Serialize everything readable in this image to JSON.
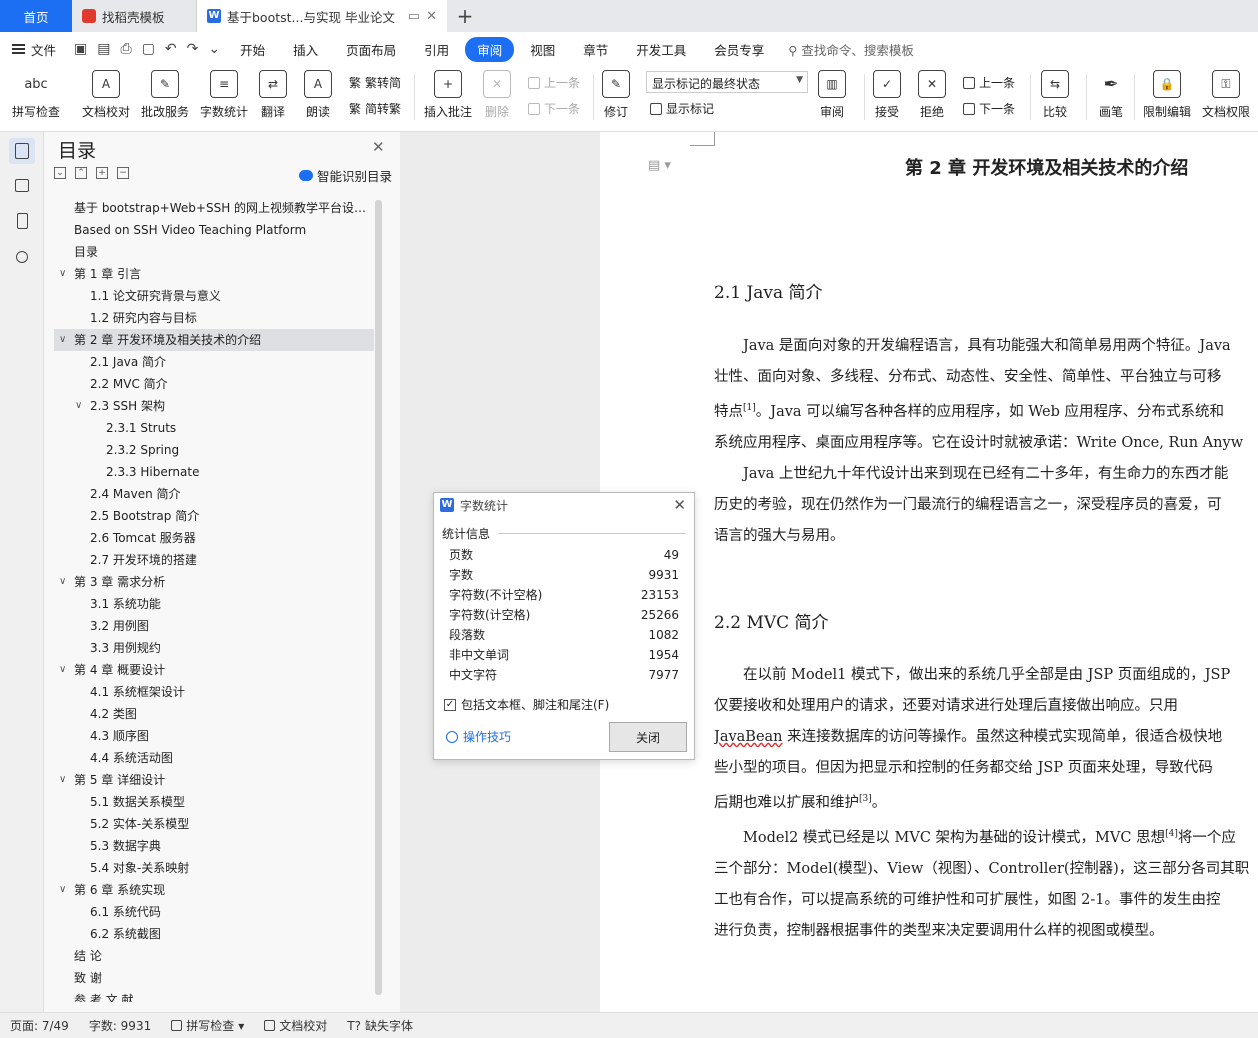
{
  "tabs": {
    "home": "首页",
    "find_template": "找稻壳模板",
    "doc": "基于bootst...与实现 毕业论文",
    "plus": "+"
  },
  "menu": {
    "file": "文件",
    "items": [
      "开始",
      "插入",
      "页面布局",
      "引用",
      "审阅",
      "视图",
      "章节",
      "开发工具",
      "会员专享"
    ],
    "active": "审阅",
    "search": "查找命令、搜索模板"
  },
  "ribbon": {
    "spellcheck": "拼写检查",
    "doc_proof": "文档校对",
    "review_service": "批改服务",
    "word_count": "字数统计",
    "translate": "翻译",
    "read_aloud": "朗读",
    "trad_to_simp": "繁转简",
    "simp_to_trad": "简转繁",
    "insert_comment": "插入批注",
    "delete": "删除",
    "prev": "上一条",
    "next": "下一条",
    "track": "修订",
    "markup_state": "显示标记的最终状态",
    "show_markup": "显示标记",
    "review": "审阅",
    "accept": "接受",
    "reject": "拒绝",
    "prev2": "上一条",
    "next2": "下一条",
    "compare": "比较",
    "pen": "画笔",
    "restrict_edit": "限制编辑",
    "doc_rights": "文档权限",
    "abc": "abc"
  },
  "toc": {
    "title": "目录",
    "smart": "智能识别目录",
    "items": [
      {
        "text": "基于 bootstrap+Web+SSH 的网上视频教学平台设计与实现",
        "level": 0,
        "chev": false
      },
      {
        "text": "Based on SSH Video Teaching Platform",
        "level": 0,
        "chev": false
      },
      {
        "text": "目录",
        "level": 0,
        "chev": false
      },
      {
        "text": "第 1 章  引言",
        "level": 0,
        "chev": true
      },
      {
        "text": "1.1  论文研究背景与意义",
        "level": 1,
        "chev": false
      },
      {
        "text": "1.2  研究内容与目标",
        "level": 1,
        "chev": false
      },
      {
        "text": "第 2 章  开发环境及相关技术的介绍",
        "level": 0,
        "chev": true,
        "sel": true
      },
      {
        "text": "2.1 Java 简介",
        "level": 1,
        "chev": false
      },
      {
        "text": "2.2 MVC 简介",
        "level": 1,
        "chev": false
      },
      {
        "text": "2.3 SSH 架构",
        "level": 1,
        "chev": true
      },
      {
        "text": "2.3.1 Struts",
        "level": 2,
        "chev": false
      },
      {
        "text": "2.3.2 Spring",
        "level": 2,
        "chev": false
      },
      {
        "text": "2.3.3 Hibernate",
        "level": 2,
        "chev": false
      },
      {
        "text": "2.4 Maven 简介",
        "level": 1,
        "chev": false
      },
      {
        "text": "2.5 Bootstrap 简介",
        "level": 1,
        "chev": false
      },
      {
        "text": "2.6 Tomcat 服务器",
        "level": 1,
        "chev": false
      },
      {
        "text": "2.7  开发环境的搭建",
        "level": 1,
        "chev": false
      },
      {
        "text": "第 3 章  需求分析",
        "level": 0,
        "chev": true
      },
      {
        "text": "3.1  系统功能",
        "level": 1,
        "chev": false
      },
      {
        "text": "3.2  用例图",
        "level": 1,
        "chev": false
      },
      {
        "text": "3.3  用例规约",
        "level": 1,
        "chev": false
      },
      {
        "text": "第 4 章  概要设计",
        "level": 0,
        "chev": true
      },
      {
        "text": "4.1  系统框架设计",
        "level": 1,
        "chev": false
      },
      {
        "text": "4.2  类图",
        "level": 1,
        "chev": false
      },
      {
        "text": "4.3  顺序图",
        "level": 1,
        "chev": false
      },
      {
        "text": "4.4  系统活动图",
        "level": 1,
        "chev": false
      },
      {
        "text": "第 5 章  详细设计",
        "level": 0,
        "chev": true
      },
      {
        "text": "5.1  数据关系模型",
        "level": 1,
        "chev": false
      },
      {
        "text": "5.2  实体-关系模型",
        "level": 1,
        "chev": false
      },
      {
        "text": "5.3  数据字典",
        "level": 1,
        "chev": false
      },
      {
        "text": "5.4  对象-关系映射",
        "level": 1,
        "chev": false
      },
      {
        "text": "第 6 章  系统实现",
        "level": 0,
        "chev": true
      },
      {
        "text": "6.1  系统代码",
        "level": 1,
        "chev": false
      },
      {
        "text": "6.2  系统截图",
        "level": 1,
        "chev": false
      },
      {
        "text": "结   论",
        "level": 0,
        "chev": false
      },
      {
        "text": "致   谢",
        "level": 0,
        "chev": false
      },
      {
        "text": "参 考 文 献",
        "level": 0,
        "chev": false
      }
    ]
  },
  "doc": {
    "chapter": "第 2 章  开发环境及相关技术的介绍",
    "sec1": "2.1 Java 简介",
    "p1": [
      "Java 是面向对象的开发编程语言，具有功能强大和简单易用两个特征。Java",
      "壮性、面向对象、多线程、分布式、动态性、安全性、简单性、平台独立与可移",
      "特点",
      "。Java 可以编写各种各样的应用程序，如 Web 应用程序、分布式系统和",
      "系统应用程序、桌面应用程序等。它在设计时就被承诺：Write Once, Run Anyw",
      "Java 上世纪九十年代设计出来到现在已经有二十多年，有生命力的东西才能",
      "历史的考验，现在仍然作为一门最流行的编程语言之一，深受程序员的喜爱，可",
      "语言的强大与易用。"
    ],
    "sec2": "2.2 MVC 简介",
    "p2": [
      "在以前 Model1 模式下，做出来的系统几乎全部是由 JSP 页面组成的，JSP",
      "仅要接收和处理用户的请求，还要对请求进行处理后直接做出响应。只用",
      "JavaBean",
      " 来连接数据库的访问等操作。虽然这种模式实现简单，很适合极快地",
      "些小型的项目。但因为把显示和控制的任务都交给 JSP 页面来处理，导致代码",
      "后期也难以扩展和维护",
      "。",
      "Model2 模式已经是以 MVC 架构为基础的设计模式，MVC 思想",
      "将一个应",
      "三个部分：Model(模型)、View（视图）、Controller(控制器)，这三部分各司其职",
      "工也有合作，可以提高系统的可维护性和可扩展性，如图 2-1。事件的发生由控",
      "进行负责，控制器根据事件的类型来决定要调用什么样的视图或模型。"
    ],
    "refs": {
      "r1": "[1]",
      "r3": "[3]",
      "r4": "[4]"
    }
  },
  "dialog": {
    "title": "字数统计",
    "group": "统计信息",
    "stats": [
      {
        "label": "页数",
        "value": "49"
      },
      {
        "label": "字数",
        "value": "9931"
      },
      {
        "label": "字符数(不计空格)",
        "value": "23153"
      },
      {
        "label": "字符数(计空格)",
        "value": "25266"
      },
      {
        "label": "段落数",
        "value": "1082"
      },
      {
        "label": "非中文单词",
        "value": "1954"
      },
      {
        "label": "中文字符",
        "value": "7977"
      }
    ],
    "include_check": "包括文本框、脚注和尾注(F)",
    "tips": "操作技巧",
    "close": "关闭"
  },
  "status": {
    "page": "页面: 7/49",
    "words": "字数: 9931",
    "spell": "拼写检查",
    "proof": "文档校对",
    "missing_font": "缺失字体"
  }
}
